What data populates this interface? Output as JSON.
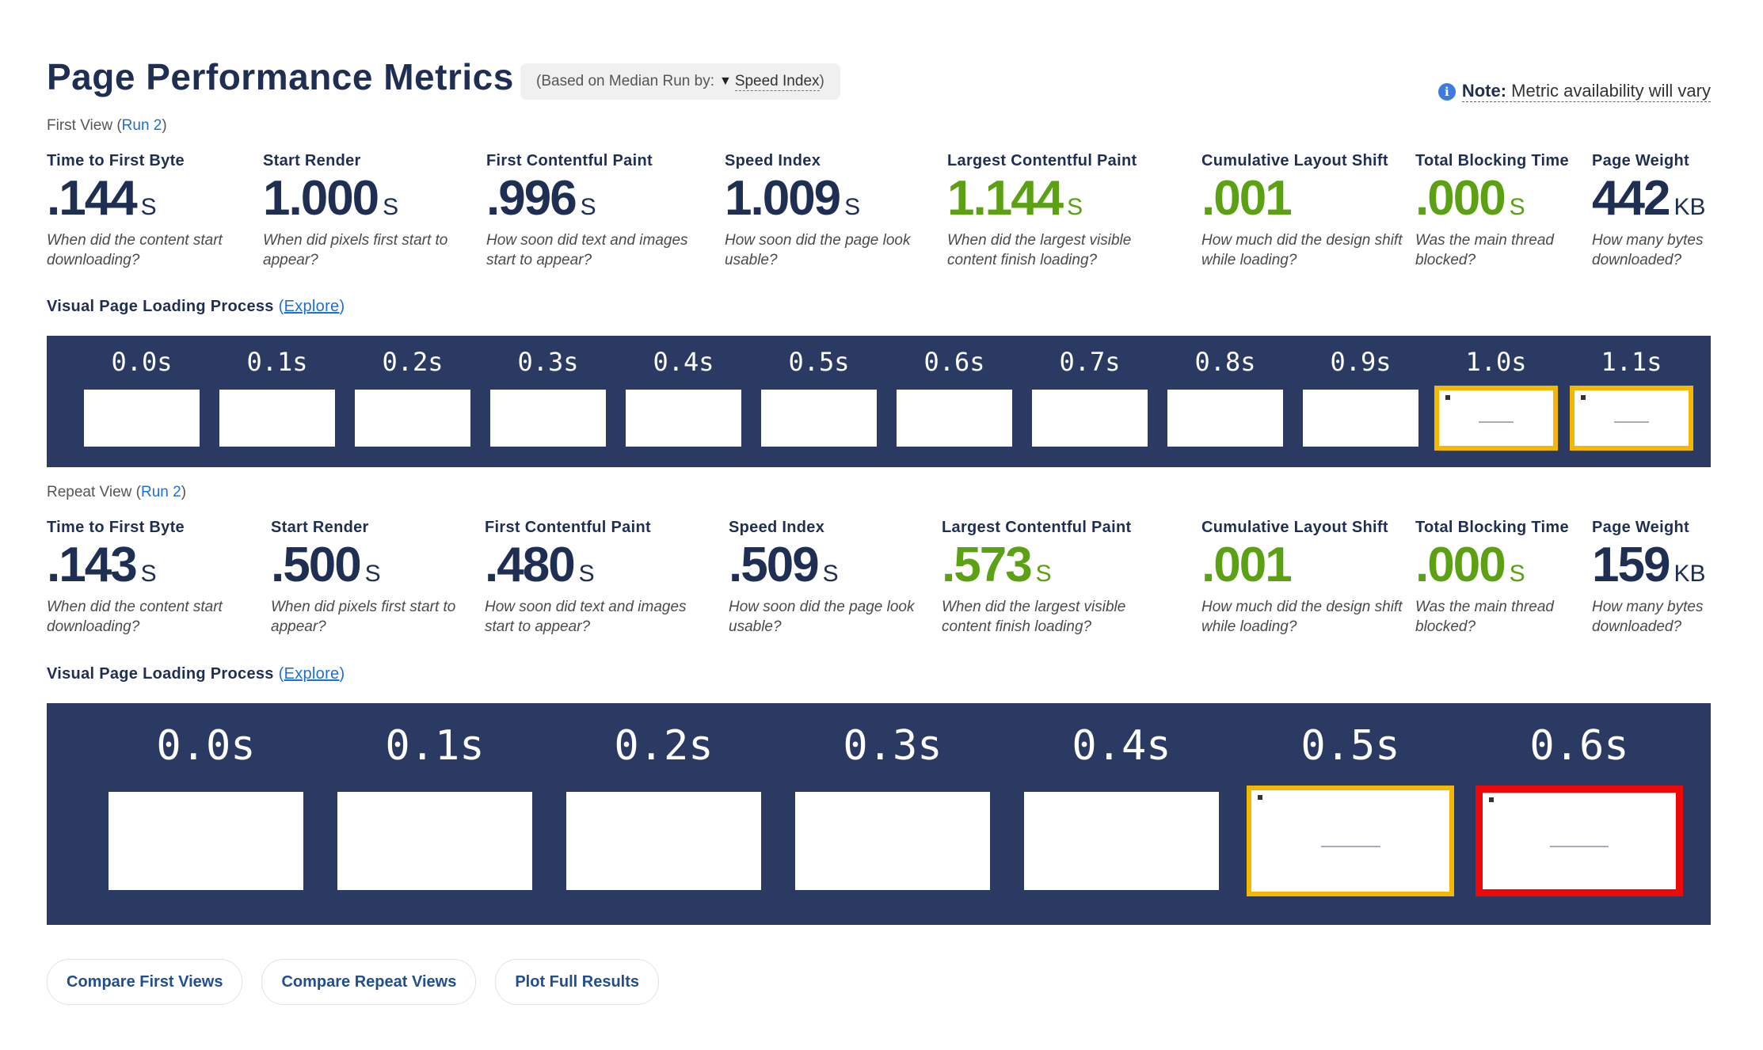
{
  "header": {
    "title": "Page Performance Metrics",
    "median_prefix": "(Based on Median Run by:",
    "median_selected": "Speed Index",
    "median_suffix": ")",
    "note_label": "Note:",
    "note_text": "Metric availability will vary"
  },
  "first_view": {
    "label": "First View (",
    "run_link": "Run 2",
    "label_close": ")",
    "metrics": [
      {
        "title": "Time to First Byte",
        "value": ".144",
        "unit": "S",
        "desc": "When did the content start downloading?"
      },
      {
        "title": "Start Render",
        "value": "1.000",
        "unit": "S",
        "desc": "When did pixels first start to appear?"
      },
      {
        "title": "First Contentful Paint",
        "value": ".996",
        "unit": "S",
        "desc": "How soon did text and images start to appear?"
      },
      {
        "title": "Speed Index",
        "value": "1.009",
        "unit": "S",
        "desc": "How soon did the page look usable?"
      },
      {
        "title": "Largest Contentful Paint",
        "value": "1.144",
        "unit": "S",
        "desc": "When did the largest visible content finish loading?"
      },
      {
        "title": "Cumulative Layout Shift",
        "value": ".001",
        "unit": "",
        "desc": "How much did the design shift while loading?"
      },
      {
        "title": "Total Blocking Time",
        "value": ".000",
        "unit": "S",
        "desc": "Was the main thread blocked?"
      },
      {
        "title": "Page Weight",
        "value": "442",
        "unit": "KB",
        "desc": "How many bytes downloaded?"
      }
    ],
    "visual_label": "Visual Page Loading Process",
    "explore_open": "(",
    "explore": "Explore",
    "explore_close": ")",
    "frames": [
      "0.0s",
      "0.1s",
      "0.2s",
      "0.3s",
      "0.4s",
      "0.5s",
      "0.6s",
      "0.7s",
      "0.8s",
      "0.9s",
      "1.0s",
      "1.1s"
    ]
  },
  "repeat_view": {
    "label": "Repeat View (",
    "run_link": "Run 2",
    "label_close": ")",
    "metrics": [
      {
        "title": "Time to First Byte",
        "value": ".143",
        "unit": "S",
        "desc": "When did the content start downloading?"
      },
      {
        "title": "Start Render",
        "value": ".500",
        "unit": "S",
        "desc": "When did pixels first start to appear?"
      },
      {
        "title": "First Contentful Paint",
        "value": ".480",
        "unit": "S",
        "desc": "How soon did text and images start to appear?"
      },
      {
        "title": "Speed Index",
        "value": ".509",
        "unit": "S",
        "desc": "How soon did the page look usable?"
      },
      {
        "title": "Largest Contentful Paint",
        "value": ".573",
        "unit": "S",
        "desc": "When did the largest visible content finish loading?"
      },
      {
        "title": "Cumulative Layout Shift",
        "value": ".001",
        "unit": "",
        "desc": "How much did the design shift while loading?"
      },
      {
        "title": "Total Blocking Time",
        "value": ".000",
        "unit": "S",
        "desc": "Was the main thread blocked?"
      },
      {
        "title": "Page Weight",
        "value": "159",
        "unit": "KB",
        "desc": "How many bytes downloaded?"
      }
    ],
    "visual_label": "Visual Page Loading Process",
    "explore_open": "(",
    "explore": "Explore",
    "explore_close": ")",
    "frames": [
      "0.0s",
      "0.1s",
      "0.2s",
      "0.3s",
      "0.4s",
      "0.5s",
      "0.6s"
    ]
  },
  "actions": {
    "compare_first": "Compare First Views",
    "compare_repeat": "Compare Repeat Views",
    "plot_full": "Plot Full Results"
  },
  "colors": {
    "good": "#5ba113",
    "filmstrip_bg": "#2a3a63",
    "changed_frame": "#f5b800",
    "lcp_frame": "#ef0808"
  }
}
